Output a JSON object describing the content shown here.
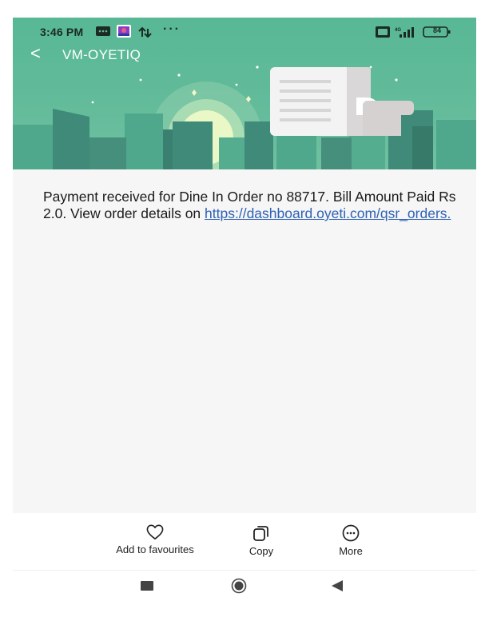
{
  "status_bar": {
    "time": "3:46 PM",
    "battery_level": "84"
  },
  "header": {
    "back_icon": "<",
    "title": "VM-OYETIQ"
  },
  "message": {
    "text": "Payment received for Dine In Order no 88717. Bill Amount Paid Rs 2.0. View order details on",
    "link": "https://dashboard.oyeti.com/qsr_orders."
  },
  "actions": [
    {
      "label": "Add to favourites",
      "icon": "heart-icon"
    },
    {
      "label": "Copy",
      "icon": "copy-icon"
    },
    {
      "label": "More",
      "icon": "more-icon"
    }
  ],
  "colors": {
    "header_green": "#5db998",
    "link_blue": "#2e62b5",
    "message_bg": "#f6f6f6"
  }
}
